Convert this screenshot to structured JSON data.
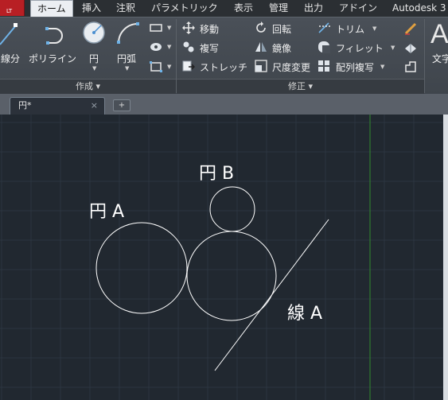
{
  "app": {
    "logo_text": "LT"
  },
  "tabs": [
    {
      "label": "ホーム",
      "active": true
    },
    {
      "label": "挿入"
    },
    {
      "label": "注釈"
    },
    {
      "label": "パラメトリック"
    },
    {
      "label": "表示"
    },
    {
      "label": "管理"
    },
    {
      "label": "出力"
    },
    {
      "label": "アドイン"
    },
    {
      "label": "Autodesk 3"
    }
  ],
  "ribbon": {
    "draw_panel": {
      "title": "作成",
      "tools": {
        "line": "線分",
        "polyline": "ポリライン",
        "circle": "円",
        "arc": "円弧"
      }
    },
    "modify_panel": {
      "title": "修正",
      "tools": {
        "move": "移動",
        "rotate": "回転",
        "trim": "トリム",
        "copy": "複写",
        "mirror": "鏡像",
        "fillet": "フィレット",
        "stretch": "ストレッチ",
        "scale": "尺度変更",
        "array": "配列複写"
      }
    },
    "annotation_panel": {
      "label": "文字"
    }
  },
  "file_tabs": [
    {
      "label": "円*",
      "close": "×"
    }
  ],
  "new_tab_label": "+",
  "canvas": {
    "labels": {
      "circle_b": "円 B",
      "circle_a": "円 A",
      "line_a": "線 A"
    },
    "colors": {
      "background": "#212830",
      "grid": "#2c3540",
      "entities": "#ffffff",
      "y_axis": "#2f7a2f"
    }
  }
}
